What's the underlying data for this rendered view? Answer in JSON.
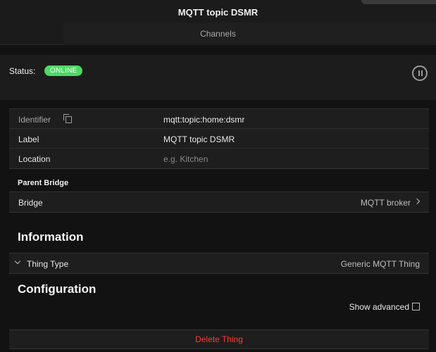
{
  "navbar": {
    "title": "MQTT topic DSMR",
    "tabs": [
      {
        "label": "Channels"
      }
    ]
  },
  "status": {
    "label": "Status:",
    "badge": "ONLINE",
    "badge_color": "#4cd964"
  },
  "properties": {
    "rows": [
      {
        "key": "Identifier",
        "value": "mqtt:topic:home:dsmr"
      },
      {
        "key": "Label",
        "value": "MQTT topic DSMR"
      },
      {
        "key": "Location",
        "placeholder": "e.g. Kitchen"
      }
    ]
  },
  "parent_bridge": {
    "title": "Parent Bridge",
    "key": "Bridge",
    "value": "MQTT broker"
  },
  "information": {
    "title": "Information",
    "thing_type_key": "Thing Type",
    "thing_type_value": "Generic MQTT Thing"
  },
  "configuration": {
    "title": "Configuration",
    "show_advanced_label": "Show advanced"
  },
  "actions": {
    "delete_label": "Delete Thing",
    "delete_color": "#ff3b30"
  },
  "icons": {
    "copy": "copy-icon",
    "pause": "pause-icon",
    "chevron_right": "chevron-right-icon",
    "chevron_down": "chevron-down-icon"
  }
}
